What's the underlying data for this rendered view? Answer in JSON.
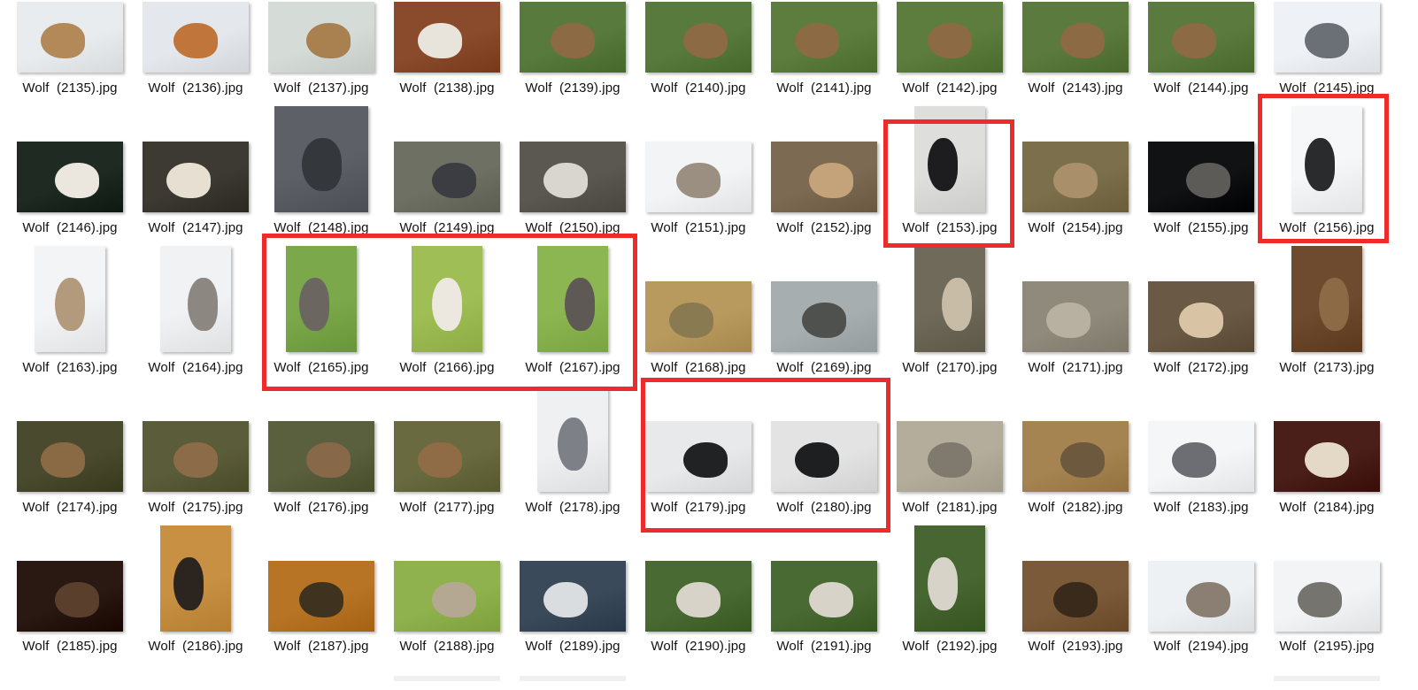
{
  "files": [
    {
      "name": "Wolf  (2135).jpg",
      "bg": "#e9ecef",
      "fg": "#b4895a"
    },
    {
      "name": "Wolf  (2136).jpg",
      "bg": "#e4e8ec",
      "fg": "#c0763a"
    },
    {
      "name": "Wolf  (2137).jpg",
      "bg": "#d5dbd7",
      "fg": "#a9804f"
    },
    {
      "name": "Wolf  (2138).jpg",
      "bg": "#8a4b2c",
      "fg": "#e8e4dc"
    },
    {
      "name": "Wolf  (2139).jpg",
      "bg": "#587a3c",
      "fg": "#8b6a44"
    },
    {
      "name": "Wolf  (2140).jpg",
      "bg": "#587a3c",
      "fg": "#8b6a44"
    },
    {
      "name": "Wolf  (2141).jpg",
      "bg": "#5c7d3e",
      "fg": "#8b6a44"
    },
    {
      "name": "Wolf  (2142).jpg",
      "bg": "#5c7d3e",
      "fg": "#8b6a44"
    },
    {
      "name": "Wolf  (2143).jpg",
      "bg": "#5b7a3d",
      "fg": "#8b6a44"
    },
    {
      "name": "Wolf  (2144).jpg",
      "bg": "#5b7a3d",
      "fg": "#8b6a44"
    },
    {
      "name": "Wolf  (2145).jpg",
      "bg": "#eef1f5",
      "fg": "#6b6f76"
    },
    {
      "name": "Wolf  (2146).jpg",
      "bg": "#1f2a22",
      "fg": "#ece7de"
    },
    {
      "name": "Wolf  (2147).jpg",
      "bg": "#3c3a33",
      "fg": "#e7dfd2"
    },
    {
      "name": "Wolf  (2148).jpg",
      "bg": "#5d6066",
      "fg": "#34373c"
    },
    {
      "name": "Wolf  (2149).jpg",
      "bg": "#6e7064",
      "fg": "#3b3d42"
    },
    {
      "name": "Wolf  (2150).jpg",
      "bg": "#5a5850",
      "fg": "#d9d6d0"
    },
    {
      "name": "Wolf  (2151).jpg",
      "bg": "#f2f4f6",
      "fg": "#9a8f80"
    },
    {
      "name": "Wolf  (2152).jpg",
      "bg": "#7d6a52",
      "fg": "#c4a37a"
    },
    {
      "name": "Wolf  (2153).jpg",
      "bg": "#dedfdd",
      "fg": "#1d1d1f"
    },
    {
      "name": "Wolf  (2154).jpg",
      "bg": "#7b6f4c",
      "fg": "#a98f6a"
    },
    {
      "name": "Wolf  (2155).jpg",
      "bg": "#111213",
      "fg": "#5d5b57"
    },
    {
      "name": "Wolf  (2156).jpg",
      "bg": "#f6f7f8",
      "fg": "#2a2b2d"
    },
    {
      "name": "Wolf  (2163).jpg",
      "bg": "#f3f4f6",
      "fg": "#b39a7d"
    },
    {
      "name": "Wolf  (2164).jpg",
      "bg": "#f1f2f4",
      "fg": "#8c8780"
    },
    {
      "name": "Wolf  (2165).jpg",
      "bg": "#7aa84a",
      "fg": "#6c6660"
    },
    {
      "name": "Wolf  (2166).jpg",
      "bg": "#9fbe55",
      "fg": "#ece8df"
    },
    {
      "name": "Wolf  (2167).jpg",
      "bg": "#8cb651",
      "fg": "#5e5954"
    },
    {
      "name": "Wolf  (2168).jpg",
      "bg": "#b99a5e",
      "fg": "#8a7a52"
    },
    {
      "name": "Wolf  (2169).jpg",
      "bg": "#a7aeb0",
      "fg": "#4f514e"
    },
    {
      "name": "Wolf  (2170).jpg",
      "bg": "#6f6a5a",
      "fg": "#c9bca6"
    },
    {
      "name": "Wolf  (2171).jpg",
      "bg": "#8f8a7b",
      "fg": "#b8b0a0"
    },
    {
      "name": "Wolf  (2172).jpg",
      "bg": "#6a5a45",
      "fg": "#d8c4a5"
    },
    {
      "name": "Wolf  (2173).jpg",
      "bg": "#6e4a2e",
      "fg": "#8d6a46"
    },
    {
      "name": "Wolf  (2174).jpg",
      "bg": "#4a4a2e",
      "fg": "#8a6a44"
    },
    {
      "name": "Wolf  (2175).jpg",
      "bg": "#5b5c3a",
      "fg": "#8c6b48"
    },
    {
      "name": "Wolf  (2176).jpg",
      "bg": "#5a5f3e",
      "fg": "#87694a"
    },
    {
      "name": "Wolf  (2177).jpg",
      "bg": "#6a6a40",
      "fg": "#8f6c45"
    },
    {
      "name": "Wolf  (2178).jpg",
      "bg": "#eef0f2",
      "fg": "#7e8088"
    },
    {
      "name": "Wolf  (2179).jpg",
      "bg": "#e7e9ea",
      "fg": "#202224"
    },
    {
      "name": "Wolf  (2180).jpg",
      "bg": "#e2e3e2",
      "fg": "#1e1f21"
    },
    {
      "name": "Wolf  (2181).jpg",
      "bg": "#b4ad9c",
      "fg": "#807a6e"
    },
    {
      "name": "Wolf  (2182).jpg",
      "bg": "#a68452",
      "fg": "#6d5a3e"
    },
    {
      "name": "Wolf  (2183).jpg",
      "bg": "#f5f6f8",
      "fg": "#6c6e74"
    },
    {
      "name": "Wolf  (2184).jpg",
      "bg": "#4a1f1a",
      "fg": "#e4d8c6"
    },
    {
      "name": "Wolf  (2185).jpg",
      "bg": "#2a1812",
      "fg": "#5a3f2c"
    },
    {
      "name": "Wolf  (2186).jpg",
      "bg": "#c89042",
      "fg": "#2c241e"
    },
    {
      "name": "Wolf  (2187).jpg",
      "bg": "#b67424",
      "fg": "#3f3320"
    },
    {
      "name": "Wolf  (2188).jpg",
      "bg": "#8fb24e",
      "fg": "#b5a892"
    },
    {
      "name": "Wolf  (2189).jpg",
      "bg": "#3b4a5a",
      "fg": "#d9dde0"
    },
    {
      "name": "Wolf  (2190).jpg",
      "bg": "#4a6a34",
      "fg": "#d8d3c8"
    },
    {
      "name": "Wolf  (2191).jpg",
      "bg": "#4a6a34",
      "fg": "#d8d3c8"
    },
    {
      "name": "Wolf  (2192).jpg",
      "bg": "#476632",
      "fg": "#d8d3c8"
    },
    {
      "name": "Wolf  (2193).jpg",
      "bg": "#7a5a38",
      "fg": "#3a2a1c"
    },
    {
      "name": "Wolf  (2194).jpg",
      "bg": "#eef1f4",
      "fg": "#8a7f72"
    },
    {
      "name": "Wolf  (2195).jpg",
      "bg": "#f2f4f6",
      "fg": "#76746f"
    }
  ],
  "highlight_colors": {
    "box": "#ee2a2a"
  }
}
